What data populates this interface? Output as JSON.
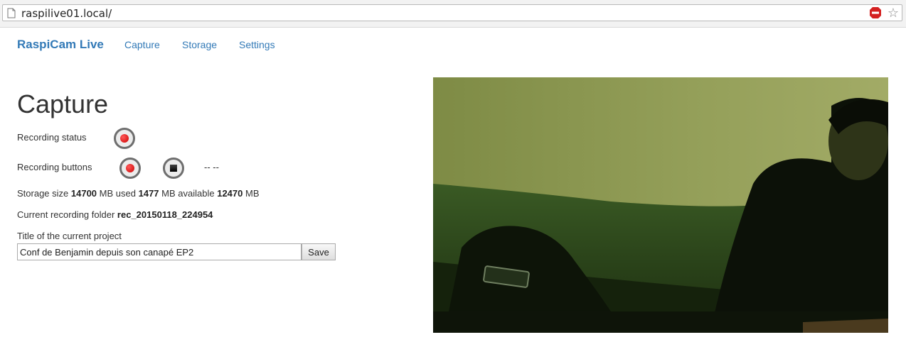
{
  "browser": {
    "url": "raspilive01.local/"
  },
  "navbar": {
    "brand": "RaspiCam Live",
    "links": [
      "Capture",
      "Storage",
      "Settings"
    ]
  },
  "capture": {
    "heading": "Capture",
    "recording_status_label": "Recording status",
    "recording_buttons_label": "Recording buttons",
    "timer": "-- --",
    "storage": {
      "prefix": "Storage size",
      "size": "14700",
      "unit1": "MB used",
      "used": "1477",
      "unit2": "MB available",
      "available": "12470",
      "unit3": "MB"
    },
    "folder": {
      "prefix": "Current recording folder",
      "name": "rec_20150118_224954"
    },
    "project": {
      "label": "Title of the current project",
      "value": "Conf de Benjamin depuis son canapé EP2",
      "save_label": "Save"
    }
  },
  "icons": {
    "page": "page-icon",
    "extension": "no-entry-extension-icon",
    "bookmark": "star-icon",
    "record": "record-icon",
    "stop": "stop-icon"
  },
  "colors": {
    "link": "#337ab7",
    "record": "#cc0000",
    "button_ring": "#6e6e6e"
  }
}
